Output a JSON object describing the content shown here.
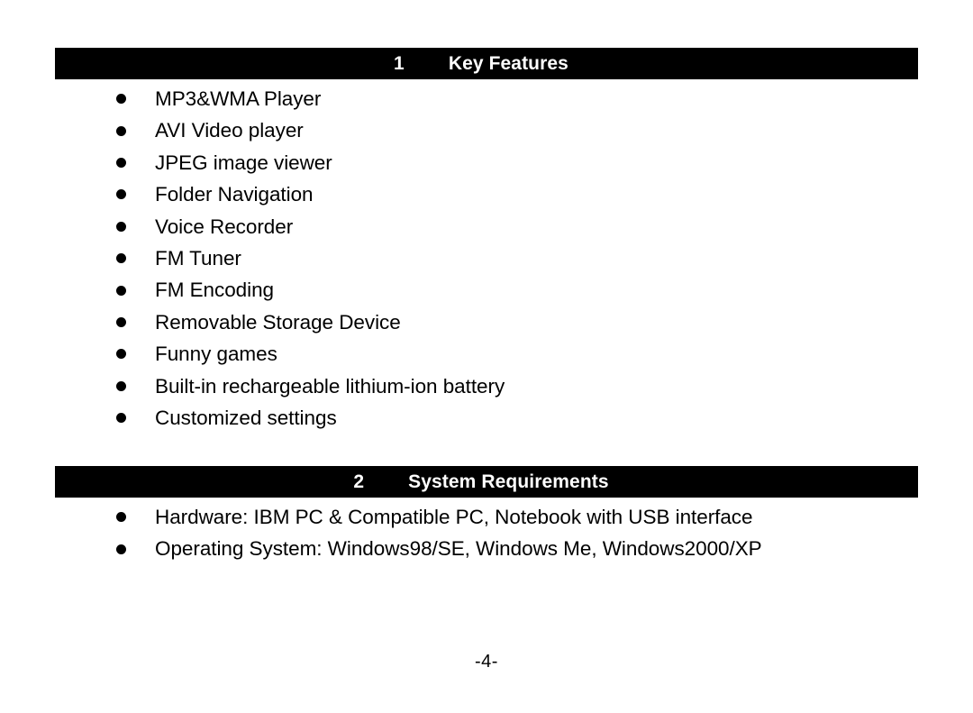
{
  "document": {
    "page_number_label": "-4-"
  },
  "sections": [
    {
      "number": "1",
      "title": "Key Features",
      "items": [
        "MP3&WMA Player",
        "AVI Video player",
        "JPEG image viewer",
        "Folder Navigation",
        "Voice Recorder",
        "FM Tuner",
        "FM Encoding",
        "Removable Storage Device",
        "Funny games",
        "Built-in rechargeable lithium-ion battery",
        "Customized settings"
      ]
    },
    {
      "number": "2",
      "title": "System Requirements",
      "items": [
        "Hardware: IBM PC & Compatible PC, Notebook with USB interface",
        "Operating System: Windows98/SE, Windows Me, Windows2000/XP"
      ]
    }
  ],
  "colors": {
    "page_background": "#ffffff",
    "header_bar_background": "#000000",
    "header_bar_text": "#ffffff",
    "body_text": "#000000"
  }
}
